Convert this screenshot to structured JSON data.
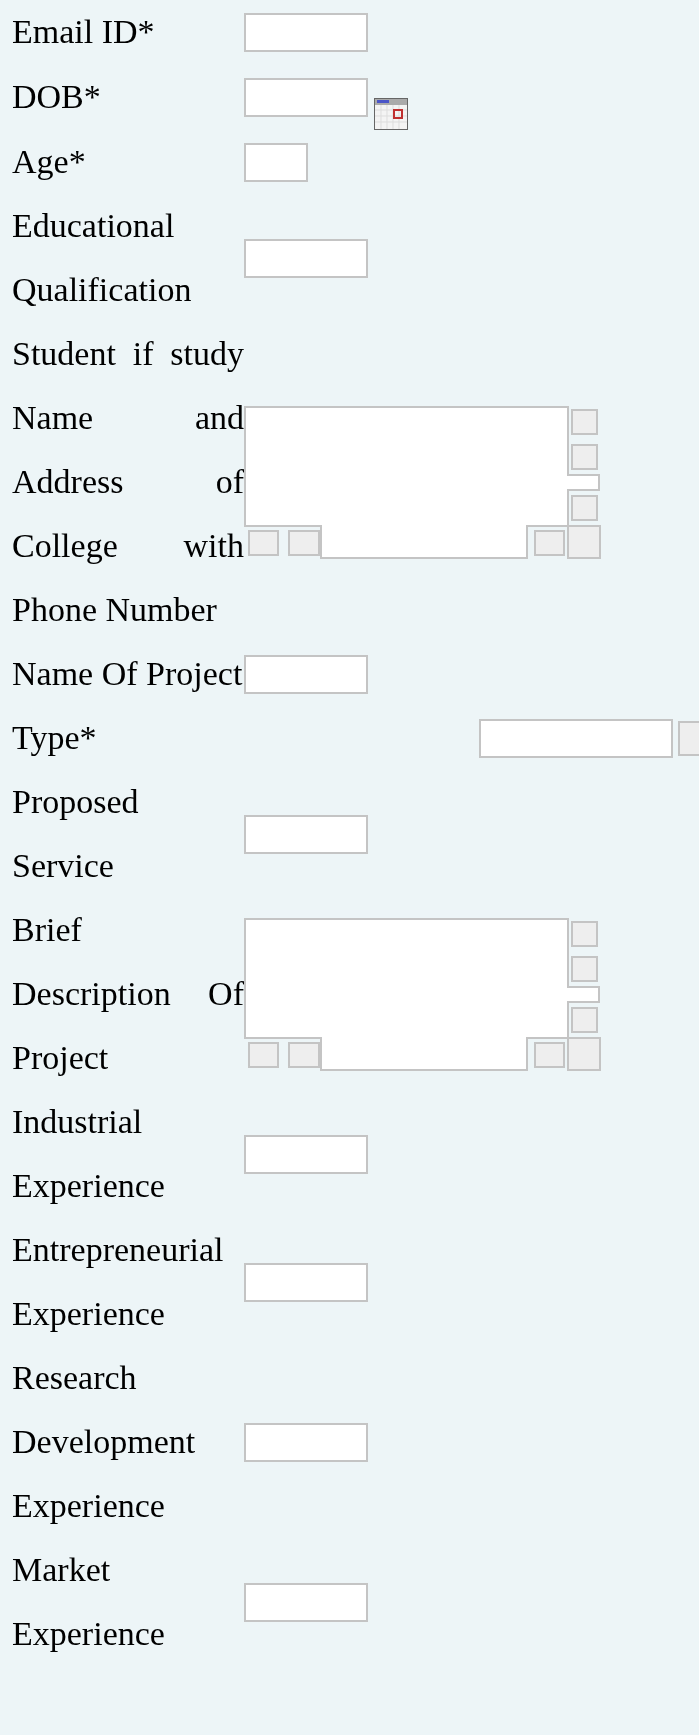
{
  "form": {
    "rows": [
      {
        "label": "Email ID*",
        "kind": "input"
      },
      {
        "label": "DOB*",
        "kind": "date"
      },
      {
        "label": "Age*",
        "kind": "short"
      },
      {
        "label": "Educational Qualification",
        "kind": "input"
      },
      {
        "label": "Student if study Name and Address of College with Phone Number",
        "kind": "editor"
      },
      {
        "label": "Name Of Project",
        "kind": "input"
      },
      {
        "label": "Type*",
        "kind": "offset"
      },
      {
        "label": "Proposed Service",
        "kind": "input"
      },
      {
        "label": "Brief Description Of Project",
        "kind": "editor"
      },
      {
        "label": "Industrial Experience",
        "kind": "input"
      },
      {
        "label": "Entrepreneurial Experience",
        "kind": "input"
      },
      {
        "label": "Research Development Experience",
        "kind": "input"
      },
      {
        "label": "Market Experience",
        "kind": "input"
      }
    ]
  }
}
